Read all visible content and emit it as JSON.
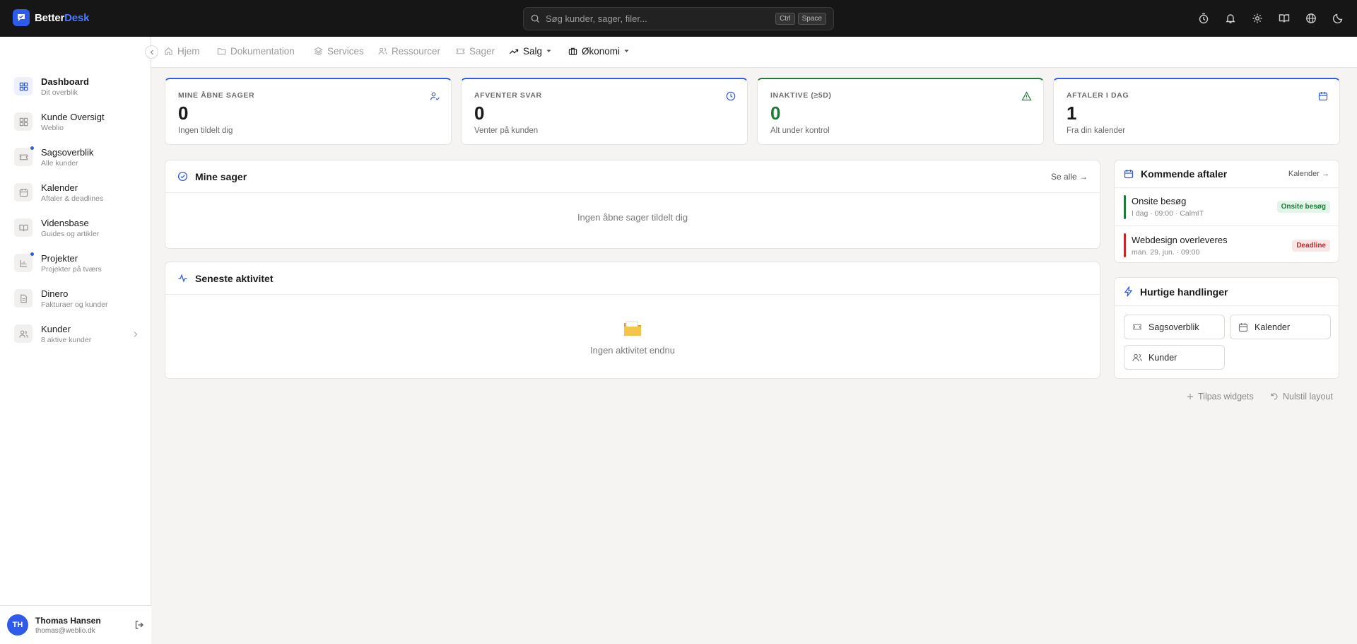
{
  "brand": {
    "name_prefix": "Better",
    "name_suffix": "Desk"
  },
  "search": {
    "placeholder": "Søg kunder, sager, filer...",
    "kbd_1": "Ctrl",
    "kbd_2": "Space"
  },
  "topbar_icons": [
    "timer-icon",
    "bell-icon",
    "gear-icon",
    "book-icon",
    "globe-icon",
    "moon-icon"
  ],
  "sidebar": {
    "items": [
      {
        "label": "Dashboard",
        "sub": "Dit overblik",
        "active": true
      },
      {
        "label": "Kunde Oversigt",
        "sub": "Weblio"
      },
      {
        "label": "Sagsoverblik",
        "sub": "Alle kunder",
        "dot": true
      },
      {
        "label": "Kalender",
        "sub": "Aftaler & deadlines"
      },
      {
        "label": "Vidensbase",
        "sub": "Guides og artikler"
      },
      {
        "label": "Projekter",
        "sub": "Projekter på tværs",
        "dot": true
      },
      {
        "label": "Dinero",
        "sub": "Fakturaer og kunder"
      },
      {
        "label": "Kunder",
        "sub": "8 aktive kunder"
      }
    ]
  },
  "user": {
    "initials": "TH",
    "name": "Thomas Hansen",
    "email": "thomas@weblio.dk"
  },
  "tabs": [
    "Hjem",
    "Dokumentation",
    "Services",
    "Ressourcer",
    "Sager",
    "Salg",
    "Økonomi"
  ],
  "stats": [
    {
      "label": "MINE ÅBNE SAGER",
      "value": "0",
      "sub": "Ingen tildelt dig"
    },
    {
      "label": "AFVENTER SVAR",
      "value": "0",
      "sub": "Venter på kunden"
    },
    {
      "label": "INAKTIVE (≥5D)",
      "value": "0",
      "sub": "Alt under kontrol"
    },
    {
      "label": "AFTALER I DAG",
      "value": "1",
      "sub": "Fra din kalender"
    }
  ],
  "my_cases": {
    "title": "Mine sager",
    "link": "Se alle →",
    "empty": "Ingen åbne sager tildelt dig"
  },
  "activity": {
    "title": "Seneste aktivitet",
    "empty": "Ingen aktivitet endnu"
  },
  "appointments": {
    "title": "Kommende aftaler",
    "link": "Kalender →",
    "items": [
      {
        "title": "Onsite besøg",
        "sub": "I dag · 09:00 · CalmIT",
        "badge": "Onsite besøg",
        "color": "#1f7a3a"
      },
      {
        "title": "Webdesign overleveres",
        "sub": "man. 29. jun. · 09:00",
        "badge": "Deadline",
        "color": "#c62828"
      }
    ]
  },
  "quick_actions": {
    "title": "Hurtige handlinger",
    "buttons": [
      "Sagsoverblik",
      "Kalender",
      "Kunder"
    ]
  },
  "footer": {
    "customize": "Tilpas widgets",
    "reset": "Nulstil layout"
  },
  "colors": {
    "accent": "#2f5bea",
    "success": "#1f7a3a",
    "danger": "#c62828",
    "topbar": "#161616"
  }
}
